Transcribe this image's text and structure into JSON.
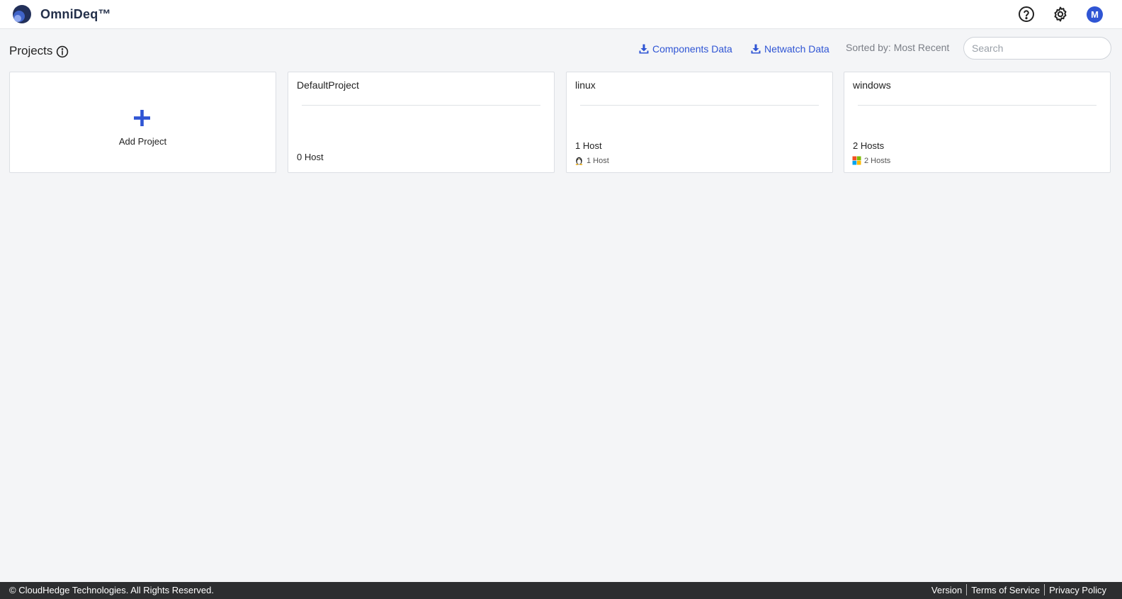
{
  "header": {
    "brand": "OmniDeq™",
    "logo_icon": "omnideq-logo",
    "help_icon": "help-circle-icon",
    "settings_icon": "gear-icon",
    "avatar_initial": "M"
  },
  "toolbar": {
    "page_title": "Projects",
    "info_icon": "info-icon",
    "components_link": "Components Data",
    "netwatch_link": "Netwatch Data",
    "sorted_label": "Sorted by: Most Recent",
    "search_placeholder": "Search",
    "search_value": ""
  },
  "add_card": {
    "label": "Add Project",
    "icon": "plus-icon",
    "accent": "#2f55d4"
  },
  "projects": [
    {
      "name": "DefaultProject",
      "host_total": "0 Host",
      "os_hosts": []
    },
    {
      "name": "linux",
      "host_total": "1 Host",
      "os_hosts": [
        {
          "os_icon": "linux-icon",
          "label": "1 Host"
        }
      ]
    },
    {
      "name": "windows",
      "host_total": "2 Hosts",
      "os_hosts": [
        {
          "os_icon": "windows-icon",
          "label": "2 Hosts"
        }
      ]
    }
  ],
  "footer": {
    "copyright": "© CloudHedge Technologies. All Rights Reserved.",
    "links": [
      "Version",
      "Terms of Service",
      "Privacy Policy"
    ]
  }
}
